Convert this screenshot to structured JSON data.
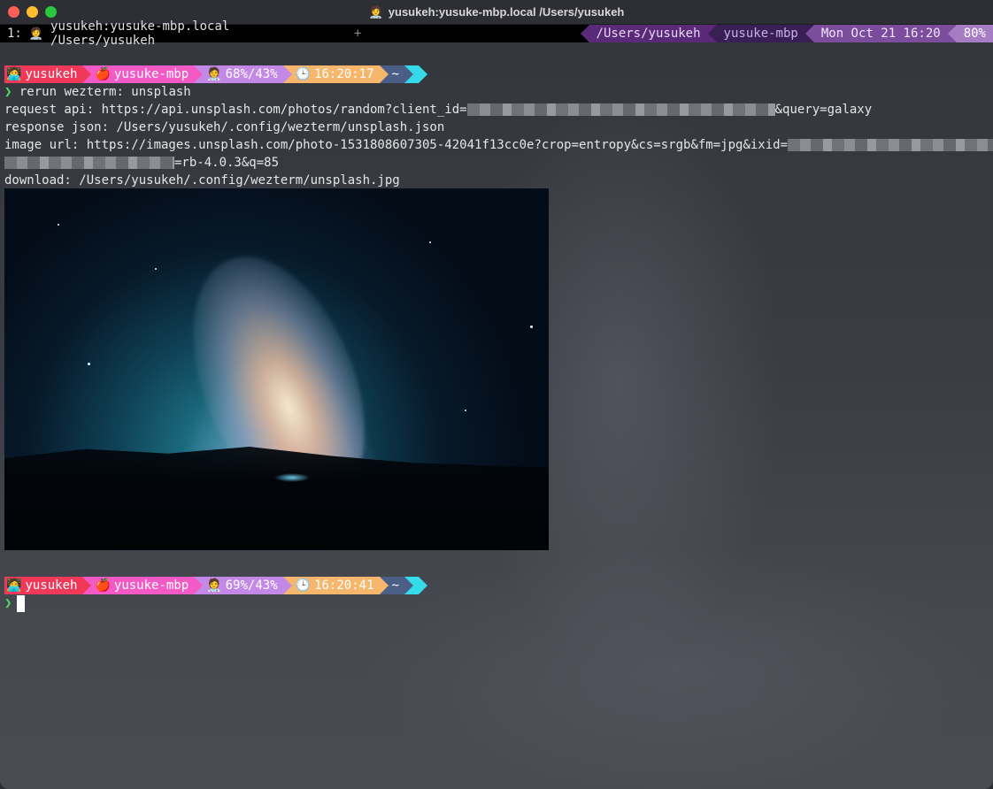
{
  "window": {
    "title": "yusukeh:yusuke-mbp.local /Users/yusukeh",
    "title_icon": "person-emoji-icon"
  },
  "tabbar": {
    "tab_index": "1:",
    "tab_title": "yusukeh:yusuke-mbp.local /Users/yusukeh",
    "new_tab": "+",
    "status": {
      "cwd": "/Users/yusukeh",
      "host": "yusuke-mbp",
      "datetime": "Mon Oct 21 16:20",
      "battery": "80%"
    }
  },
  "prompt1": {
    "user": "yusukeh",
    "host": "yusuke-mbp",
    "battery": "68%/43%",
    "time": "16:20:17",
    "dir": "~"
  },
  "output": {
    "command": "rerun wezterm: unsplash",
    "request_label": "request api: https://api.unsplash.com/photos/random?client_id=",
    "request_suffix": "&query=galaxy",
    "response": "response json: /Users/yusukeh/.config/wezterm/unsplash.json",
    "image_url_label": "image url: https://images.unsplash.com/photo-1531808607305-42041f13cc0e?crop=entropy&cs=srgb&fm=jpg&ixid=",
    "image_url_suffix": "=rb-4.0.3&q=85",
    "download": "download: /Users/yusukeh/.config/wezterm/unsplash.jpg"
  },
  "prompt2": {
    "user": "yusukeh",
    "host": "yusuke-mbp",
    "battery": "69%/43%",
    "time": "16:20:41",
    "dir": "~"
  },
  "prompt_symbol": "❯",
  "colors": {
    "prompt_caret": "#4ee06a",
    "segment_user": "#f03859",
    "segment_host": "#f45ac6",
    "segment_battery": "#c28ae6",
    "segment_time": "#f6b66b",
    "segment_dir": "#4b5f86",
    "segment_tip": "#35dbe8"
  }
}
